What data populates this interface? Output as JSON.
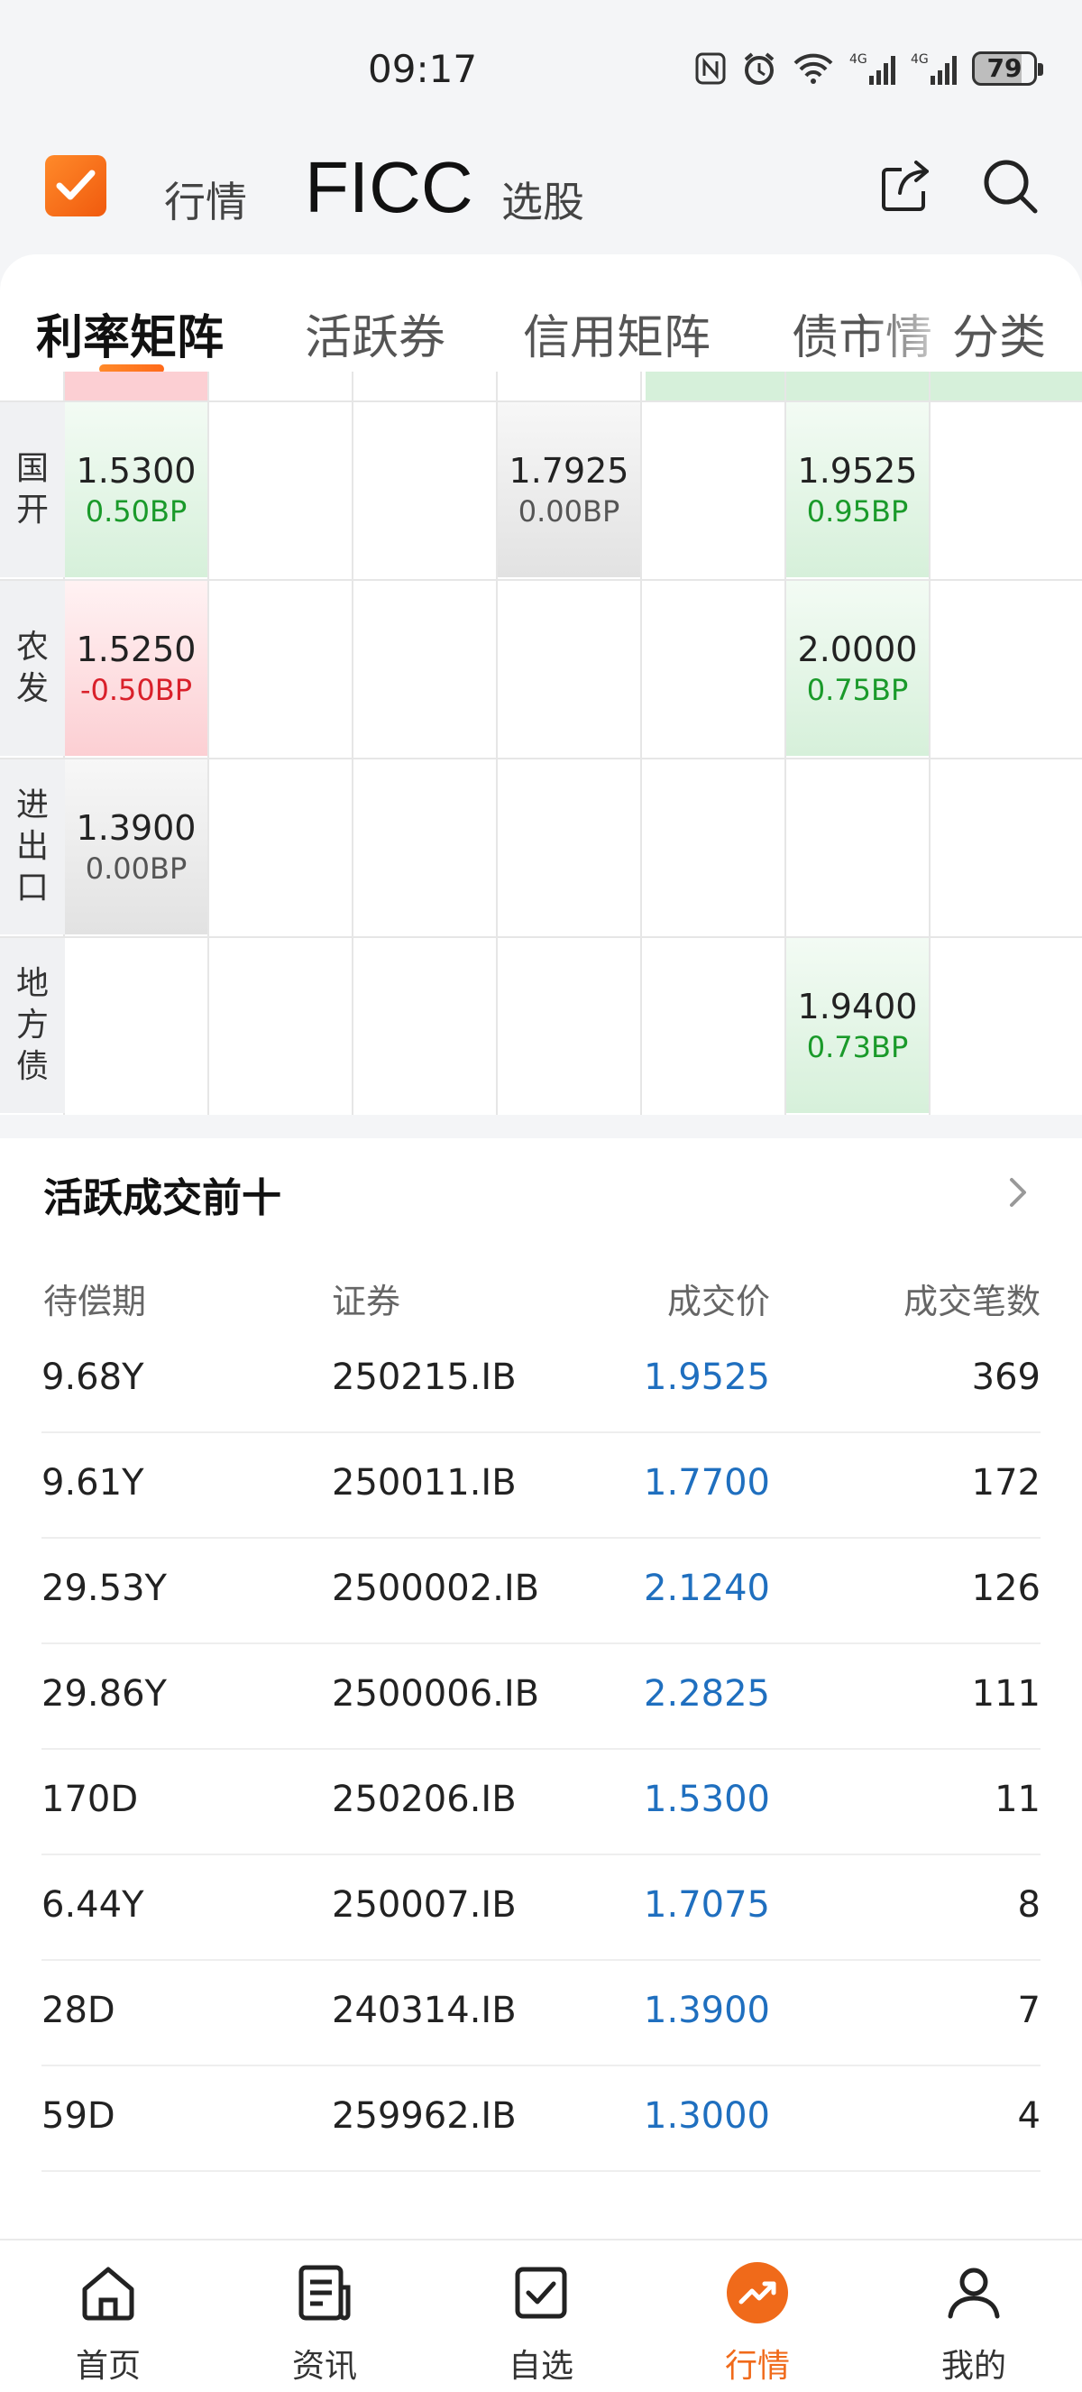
{
  "status": {
    "time": "09:17",
    "battery": "79"
  },
  "header": {
    "market": "行情",
    "ficc": "FICC",
    "select": "选股"
  },
  "tabs": [
    {
      "label": "利率矩阵"
    },
    {
      "label": "活跃券"
    },
    {
      "label": "信用矩阵"
    },
    {
      "label": "债市情"
    }
  ],
  "tab_classify": "分类",
  "matrix": {
    "rows": [
      {
        "label": [
          "国",
          "开"
        ],
        "cells": [
          {
            "col": 0,
            "value": "1.5300",
            "bp": "0.50BP",
            "tone": "green"
          },
          {
            "col": 3,
            "value": "1.7925",
            "bp": "0.00BP",
            "tone": "gray"
          },
          {
            "col": 5,
            "value": "1.9525",
            "bp": "0.95BP",
            "tone": "green"
          }
        ]
      },
      {
        "label": [
          "农",
          "发"
        ],
        "cells": [
          {
            "col": 0,
            "value": "1.5250",
            "bp": "-0.50BP",
            "tone": "red"
          },
          {
            "col": 5,
            "value": "2.0000",
            "bp": "0.75BP",
            "tone": "green"
          }
        ]
      },
      {
        "label": [
          "进",
          "出",
          "口"
        ],
        "cells": [
          {
            "col": 0,
            "value": "1.3900",
            "bp": "0.00BP",
            "tone": "gray"
          }
        ]
      },
      {
        "label": [
          "地",
          "方",
          "债"
        ],
        "cells": [
          {
            "col": 5,
            "value": "1.9400",
            "bp": "0.73BP",
            "tone": "green"
          }
        ]
      }
    ]
  },
  "trades": {
    "title": "活跃成交前十",
    "headers": {
      "term": "待偿期",
      "code": "证券",
      "price": "成交价",
      "count": "成交笔数"
    },
    "rows": [
      {
        "term": "9.68Y",
        "code": "250215.IB",
        "price": "1.9525",
        "count": "369"
      },
      {
        "term": "9.61Y",
        "code": "250011.IB",
        "price": "1.7700",
        "count": "172"
      },
      {
        "term": "29.53Y",
        "code": "2500002.IB",
        "price": "2.1240",
        "count": "126"
      },
      {
        "term": "29.86Y",
        "code": "2500006.IB",
        "price": "2.2825",
        "count": "111"
      },
      {
        "term": "170D",
        "code": "250206.IB",
        "price": "1.5300",
        "count": "11"
      },
      {
        "term": "6.44Y",
        "code": "250007.IB",
        "price": "1.7075",
        "count": "8"
      },
      {
        "term": "28D",
        "code": "240314.IB",
        "price": "1.3900",
        "count": "7"
      },
      {
        "term": "59D",
        "code": "259962.IB",
        "price": "1.3000",
        "count": "4"
      }
    ]
  },
  "bottom_nav": [
    {
      "label": "首页",
      "icon": "home-icon"
    },
    {
      "label": "资讯",
      "icon": "news-icon"
    },
    {
      "label": "自选",
      "icon": "watchlist-icon"
    },
    {
      "label": "行情",
      "icon": "market-icon",
      "active": true
    },
    {
      "label": "我的",
      "icon": "profile-icon"
    }
  ],
  "colors": {
    "accent": "#f06a1a",
    "up": "#1a9a2a",
    "down": "#d9202a",
    "link": "#1f6fbf"
  }
}
